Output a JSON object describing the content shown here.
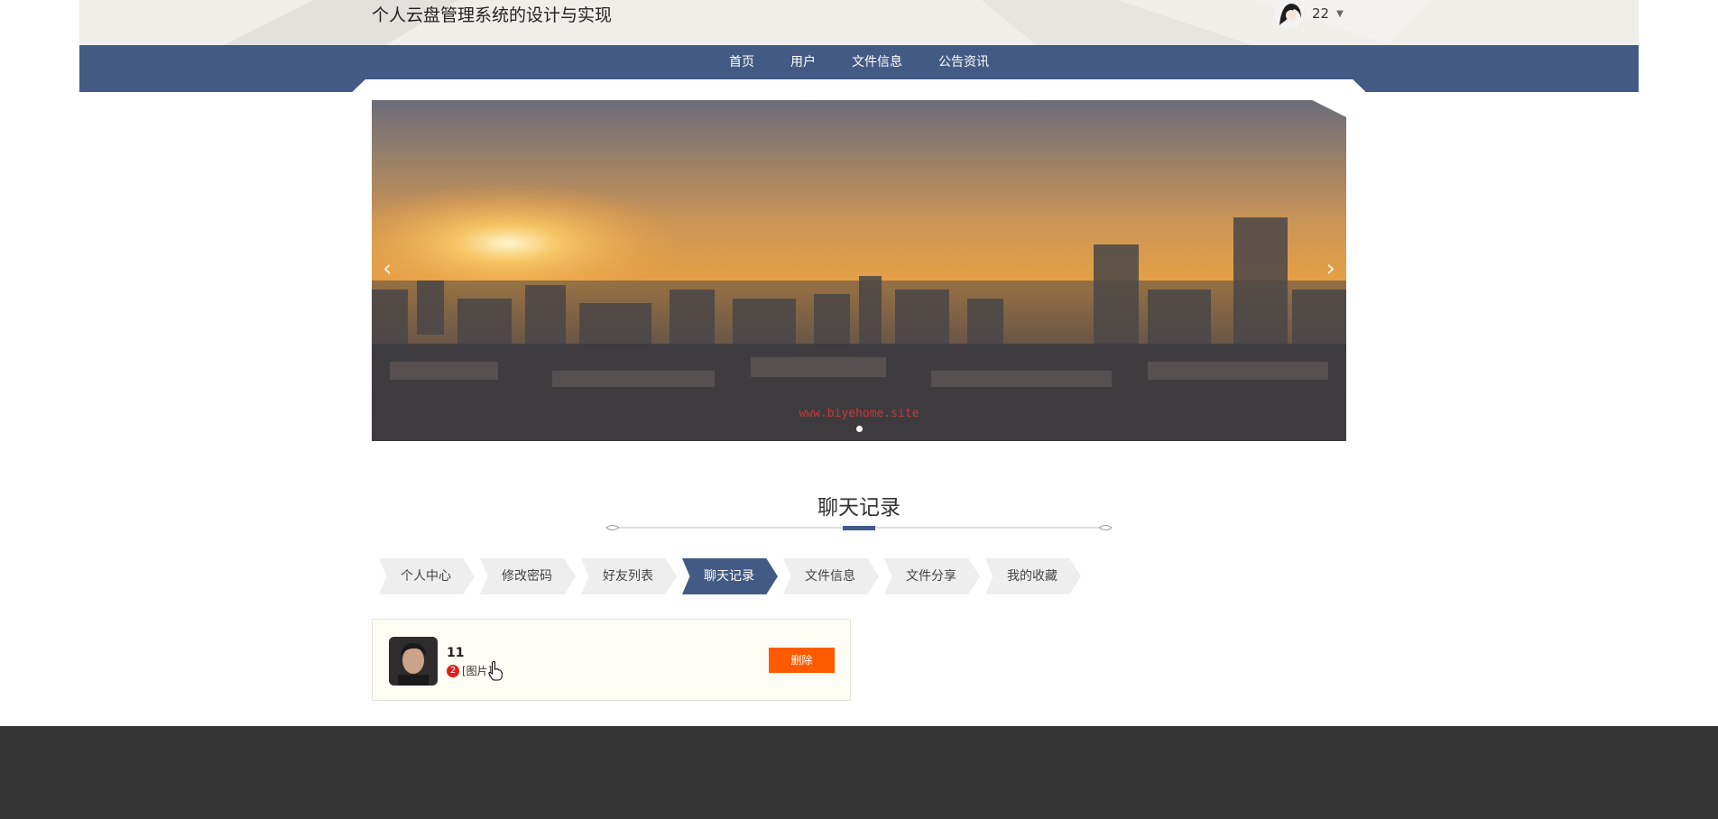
{
  "header": {
    "site_title": "个人云盘管理系统的设计与实现",
    "username": "22"
  },
  "nav": {
    "items": [
      "首页",
      "用户",
      "文件信息",
      "公告资讯"
    ]
  },
  "banner": {
    "watermark": "www.biyehome.site",
    "prev_glyph": "‹",
    "next_glyph": "›",
    "active_index": 0,
    "slide_count": 1
  },
  "section": {
    "title": "聊天记录"
  },
  "tabs": {
    "items": [
      "个人中心",
      "修改密码",
      "好友列表",
      "聊天记录",
      "文件信息",
      "文件分享",
      "我的收藏"
    ],
    "active": "聊天记录"
  },
  "chat": {
    "name": "11",
    "unread": "2",
    "message": "[图片]",
    "delete_label": "删除"
  },
  "colors": {
    "nav_blue": "#435a84",
    "delete_orange": "#ff5a00",
    "footer": "#333333",
    "badge_red": "#e02020"
  }
}
